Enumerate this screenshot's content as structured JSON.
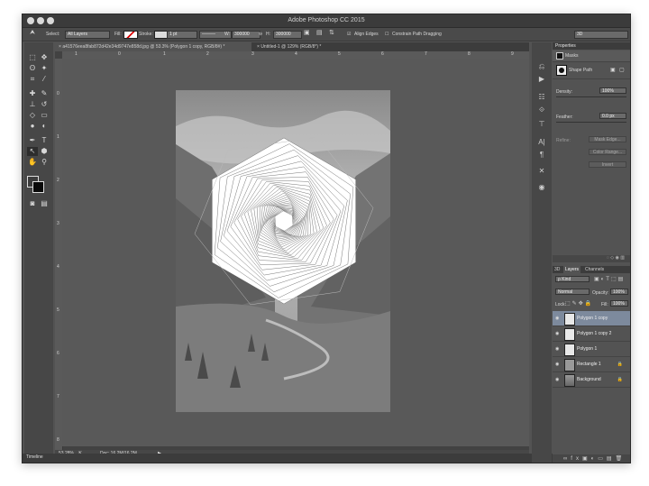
{
  "app": {
    "title": "Adobe Photoshop CC 2015"
  },
  "options_bar": {
    "select_label": "Select:",
    "select_value": "All Layers",
    "fill_label": "Fill:",
    "stroke_label": "Stroke:",
    "stroke_width": "1 pt",
    "w_label": "W:",
    "w_value": "300000",
    "h_label": "H:",
    "h_value": "300000",
    "align_edges_label": "Align Edges",
    "constrain_label": "Constrain Path Dragging",
    "workspace": "3D"
  },
  "doc_tabs": [
    {
      "label": "a41576eea8fab872d42e34d9747e858d.jpg @ 53.3% (Polygon 1 copy, RGB/8#) *"
    },
    {
      "label": "Untitled-1 @ 129% (RGB/8*) *"
    }
  ],
  "rulers": {
    "h_ticks": [
      "1",
      "0",
      "1",
      "2",
      "3",
      "4",
      "5",
      "6",
      "7",
      "8",
      "9"
    ],
    "v_ticks": [
      "0",
      "1",
      "2",
      "3",
      "4",
      "5",
      "6",
      "7",
      "8"
    ]
  },
  "status": {
    "zoom": "53.28%",
    "doc_info": "Doc: 16.2M/16.2M"
  },
  "timeline": {
    "label": "Timeline"
  },
  "properties": {
    "header": "Properties",
    "masks_label": "Masks",
    "shape_path_label": "Shape Path",
    "density_label": "Density:",
    "density_value": "100%",
    "feather_label": "Feather:",
    "feather_value": "0.0 px",
    "refine_label": "Refine:",
    "mask_edge_btn": "Mask Edge...",
    "color_range_btn": "Color Range...",
    "invert_btn": "Invert"
  },
  "layers_panel": {
    "tabs": [
      "3D",
      "Layers",
      "Channels"
    ],
    "active_tab": "Layers",
    "kind_label": "Kind",
    "blend_mode": "Normal",
    "opacity_label": "Opacity:",
    "opacity_value": "100%",
    "lock_label": "Lock:",
    "fill_label": "Fill:",
    "fill_value": "100%",
    "layers": [
      {
        "name": "Polygon 1 copy",
        "selected": true,
        "locked": false
      },
      {
        "name": "Polygon 1 copy 2",
        "selected": false,
        "locked": false
      },
      {
        "name": "Polygon 1",
        "selected": false,
        "locked": false
      },
      {
        "name": "Rectangle 1",
        "selected": false,
        "locked": true
      },
      {
        "name": "Background",
        "selected": false,
        "locked": true
      }
    ]
  },
  "colors": {
    "selection": "#7d8a9d",
    "panel": "#535353",
    "canvas_bg": "#595959"
  }
}
